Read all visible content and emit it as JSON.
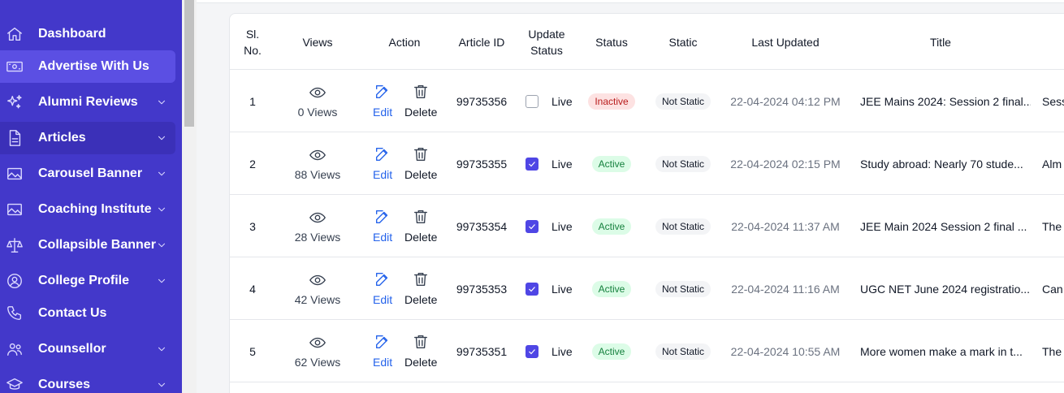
{
  "sidebar": {
    "items": [
      {
        "label": "Dashboard",
        "icon": "home-icon",
        "chevron": false
      },
      {
        "label": "Advertise With Us",
        "icon": "money-icon",
        "chevron": false
      },
      {
        "label": "Alumni Reviews",
        "icon": "sparkles-icon",
        "chevron": true
      },
      {
        "label": "Articles",
        "icon": "document-icon",
        "chevron": true
      },
      {
        "label": "Carousel Banner",
        "icon": "image-icon",
        "chevron": true
      },
      {
        "label": "Coaching Institute",
        "icon": "image-icon",
        "chevron": true
      },
      {
        "label": "Collapsible Banner",
        "icon": "scale-icon",
        "chevron": true
      },
      {
        "label": "College Profile",
        "icon": "user-circle-icon",
        "chevron": true
      },
      {
        "label": "Contact Us",
        "icon": "phone-icon",
        "chevron": false
      },
      {
        "label": "Counsellor",
        "icon": "users-icon",
        "chevron": true
      },
      {
        "label": "Courses",
        "icon": "graduation-cap-icon",
        "chevron": true
      }
    ]
  },
  "table": {
    "headers": {
      "sl_no": "Sl. No.",
      "views": "Views",
      "action": "Action",
      "article_id": "Article ID",
      "update_status": "Update Status",
      "status": "Status",
      "static": "Static",
      "last_updated": "Last Updated",
      "title": "Title"
    },
    "edit_label": "Edit",
    "delete_label": "Delete",
    "live_label": "Live",
    "rows": [
      {
        "sl": "1",
        "views": "0 Views",
        "article_id": "99735356",
        "live": false,
        "status": "Inactive",
        "static": "Not Static",
        "last_updated": "22-04-2024 04:12 PM",
        "title": "JEE Mains 2024: Session 2 final...",
        "extra": "Sess"
      },
      {
        "sl": "2",
        "views": "88 Views",
        "article_id": "99735355",
        "live": true,
        "status": "Active",
        "static": "Not Static",
        "last_updated": "22-04-2024 02:15 PM",
        "title": "Study abroad: Nearly 70 stude...",
        "extra": "Alm"
      },
      {
        "sl": "3",
        "views": "28 Views",
        "article_id": "99735354",
        "live": true,
        "status": "Active",
        "static": "Not Static",
        "last_updated": "22-04-2024 11:37 AM",
        "title": "JEE Main 2024 Session 2 final ...",
        "extra": "The"
      },
      {
        "sl": "4",
        "views": "42 Views",
        "article_id": "99735353",
        "live": true,
        "status": "Active",
        "static": "Not Static",
        "last_updated": "22-04-2024 11:16 AM",
        "title": "UGC NET June 2024 registratio...",
        "extra": "Can"
      },
      {
        "sl": "5",
        "views": "62 Views",
        "article_id": "99735351",
        "live": true,
        "status": "Active",
        "static": "Not Static",
        "last_updated": "22-04-2024 10:55 AM",
        "title": "More women make a mark in t...",
        "extra": "The"
      }
    ]
  },
  "colors": {
    "sidebar_bg": "#4338ca",
    "accent": "#4f46e5",
    "link": "#2563eb",
    "inactive_badge": "#fde2e2",
    "active_badge": "#dcfce7"
  }
}
